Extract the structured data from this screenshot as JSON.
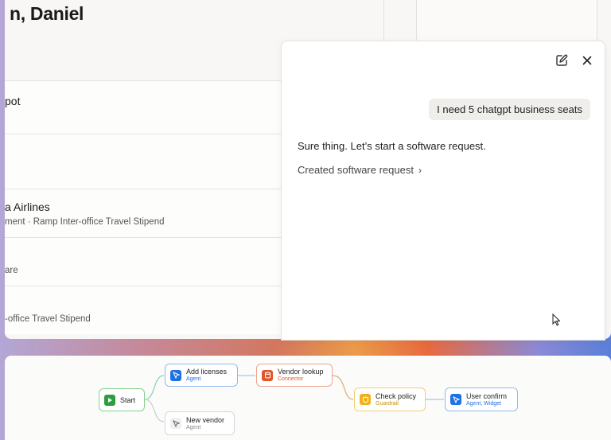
{
  "header": {
    "greeting": "n, Daniel"
  },
  "list": {
    "rows": [
      {
        "title": "pot",
        "subtitle": ""
      },
      {
        "title": "",
        "subtitle": ""
      },
      {
        "title": "a Airlines",
        "subtitle": "ment · Ramp Inter-office Travel Stipend"
      },
      {
        "title": "",
        "subtitle": "are"
      },
      {
        "title": "",
        "subtitle": "-office Travel Stipend"
      }
    ]
  },
  "chat": {
    "user_message": "I need 5 chatgpt business seats",
    "assistant_reply": "Sure thing. Let’s start a software request.",
    "link_text": "Created software request",
    "icons": {
      "edit": "edit-icon",
      "close": "close-icon"
    }
  },
  "workflow": {
    "nodes": [
      {
        "id": "start",
        "label": "Start",
        "sub": "",
        "color": "#2e9e3c",
        "icon": "play-icon"
      },
      {
        "id": "add",
        "label": "Add licenses",
        "sub": "Agent",
        "color": "#1f6fe5",
        "icon": "agent-icon"
      },
      {
        "id": "vendor",
        "label": "Vendor lookup",
        "sub": "Connector",
        "color": "#e2572a",
        "icon": "connector-icon"
      },
      {
        "id": "policy",
        "label": "Check policy",
        "sub": "Guardrail",
        "color": "#f2b11a",
        "icon": "guardrail-icon"
      },
      {
        "id": "confirm",
        "label": "User confirm",
        "sub": "Agent, Widget",
        "color": "#1f6fe5",
        "icon": "agent-icon"
      },
      {
        "id": "newvendor",
        "label": "New vendor",
        "sub": "Agent",
        "color": "#999999",
        "icon": "agent-icon"
      }
    ]
  }
}
